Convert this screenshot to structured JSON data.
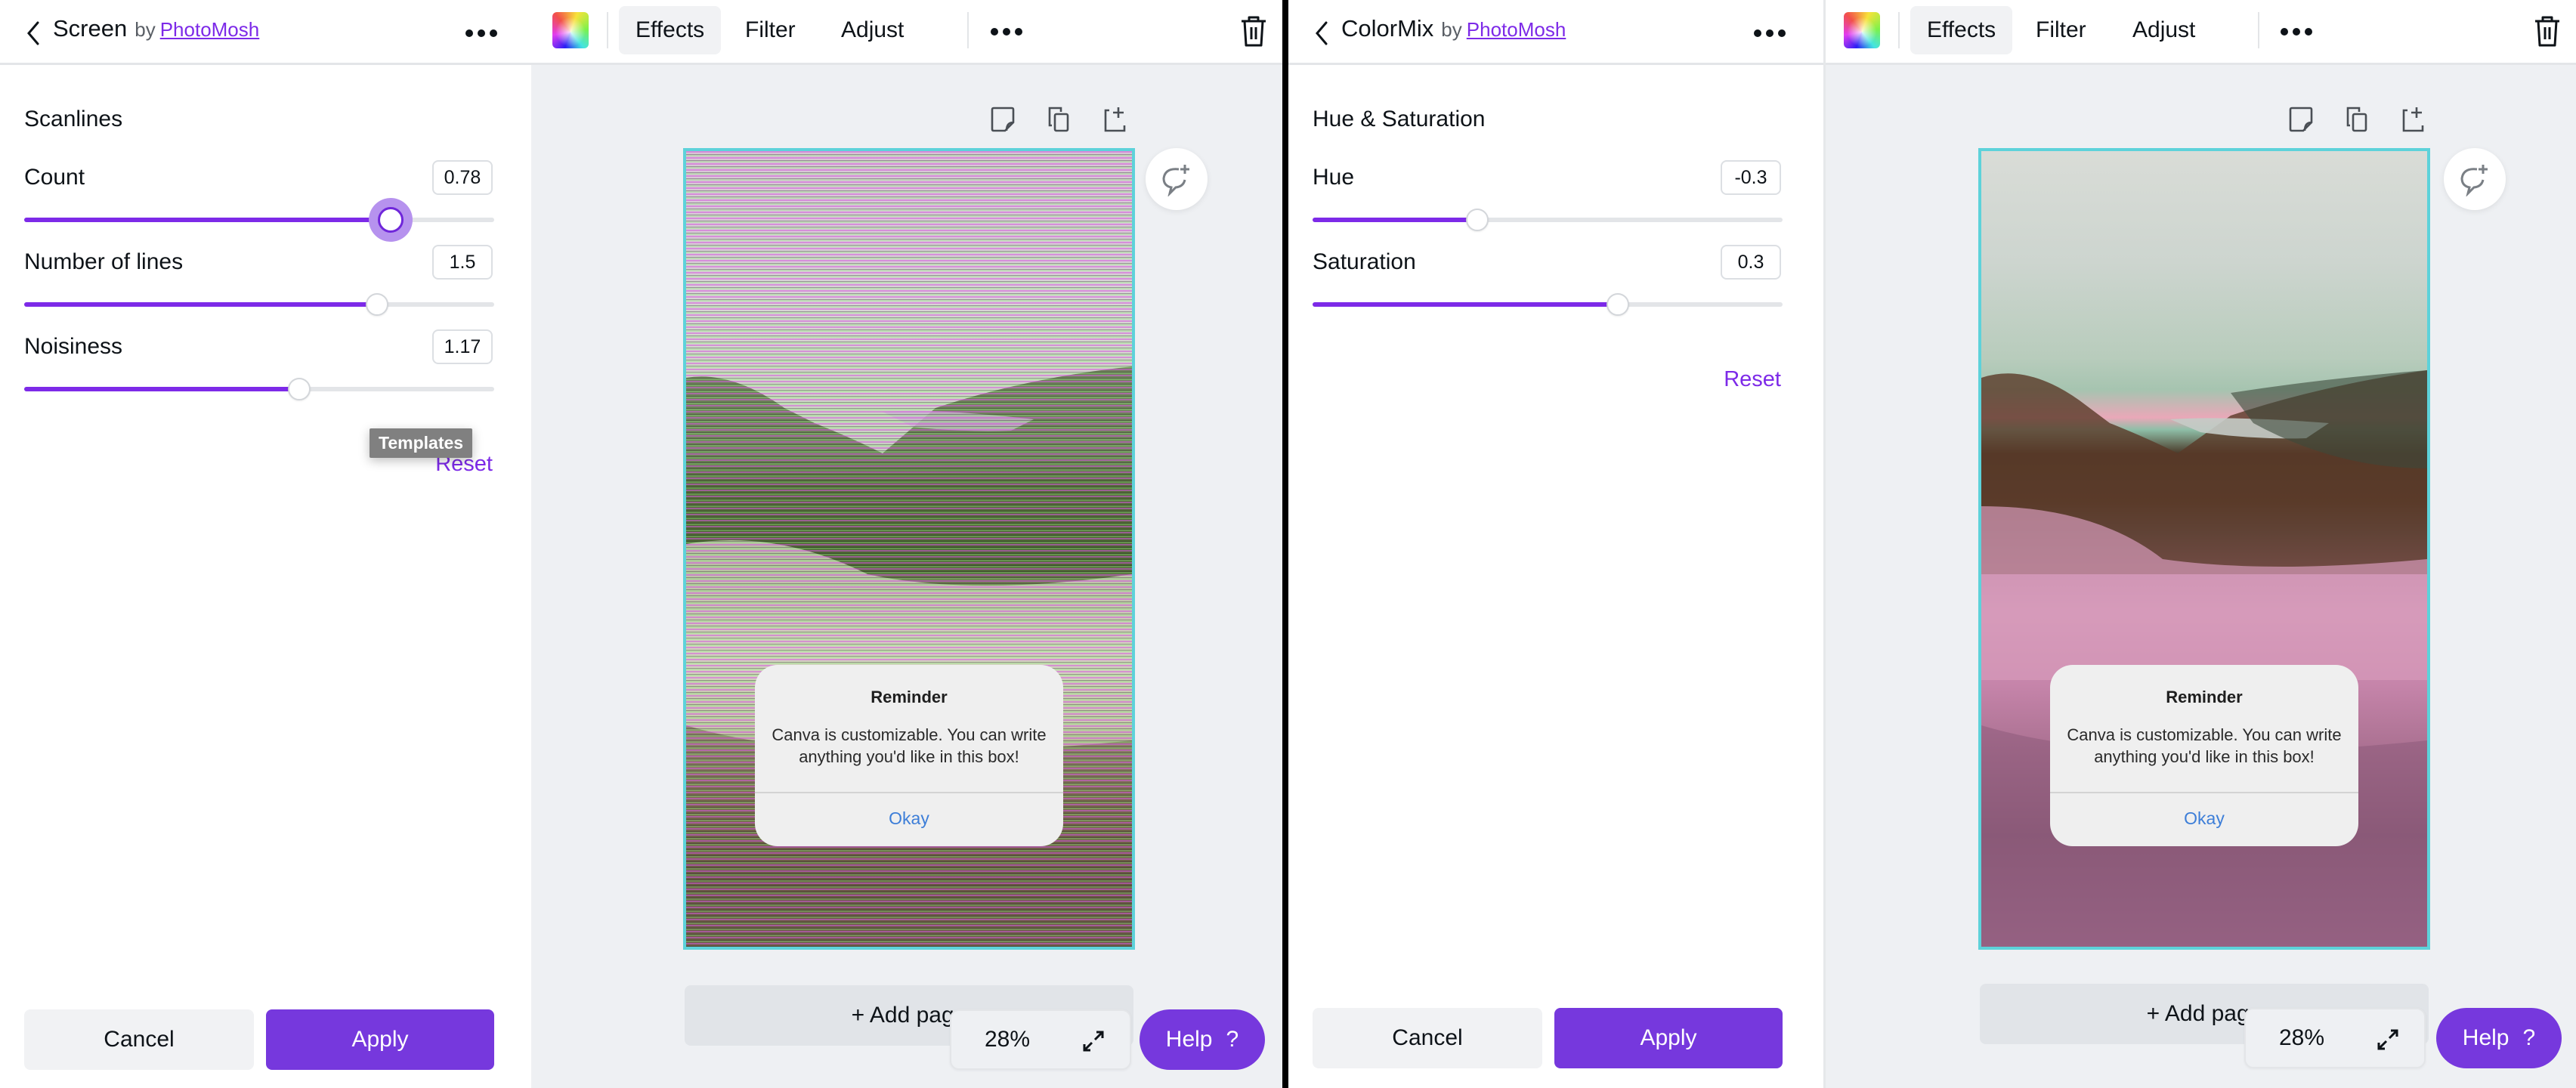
{
  "colors": {
    "accent": "#7d2ae8",
    "apply_bg": "#7638dd",
    "selection_border": "#5dd2da",
    "dialog_link": "#3d7ed8"
  },
  "left": {
    "panel": {
      "title": "Screen",
      "by": "by",
      "author": "PhotoMosh",
      "section_title": "Scanlines",
      "controls": [
        {
          "label": "Count",
          "value": "0.78",
          "fraction": 0.78,
          "active": true
        },
        {
          "label": "Number of lines",
          "value": "1.5",
          "fraction": 0.75
        },
        {
          "label": "Noisiness",
          "value": "1.17",
          "fraction": 0.585
        }
      ],
      "tooltip": "Templates",
      "reset": "Reset",
      "cancel": "Cancel",
      "apply": "Apply"
    },
    "toolbar": {
      "tabs": [
        "Effects",
        "Filter",
        "Adjust"
      ],
      "active_tab": "Effects"
    },
    "dialog": {
      "title": "Reminder",
      "body": "Canva is customizable. You can write anything you'd like in this box!",
      "ok": "Okay"
    },
    "add_page": "+ Add page",
    "zoom": "28%",
    "help": "Help",
    "help_icon": "?"
  },
  "right": {
    "panel": {
      "title": "ColorMix",
      "by": "by",
      "author": "PhotoMosh",
      "section_title": "Hue & Saturation",
      "controls": [
        {
          "label": "Hue",
          "value": "-0.3",
          "fraction": 0.35
        },
        {
          "label": "Saturation",
          "value": "0.3",
          "fraction": 0.65
        }
      ],
      "reset": "Reset",
      "cancel": "Cancel",
      "apply": "Apply"
    },
    "toolbar": {
      "tabs": [
        "Effects",
        "Filter",
        "Adjust"
      ],
      "active_tab": "Effects"
    },
    "dialog": {
      "title": "Reminder",
      "body": "Canva is customizable. You can write anything you'd like in this box!",
      "ok": "Okay"
    },
    "add_page": "+ Add page",
    "zoom": "28%",
    "help": "Help",
    "help_icon": "?"
  }
}
